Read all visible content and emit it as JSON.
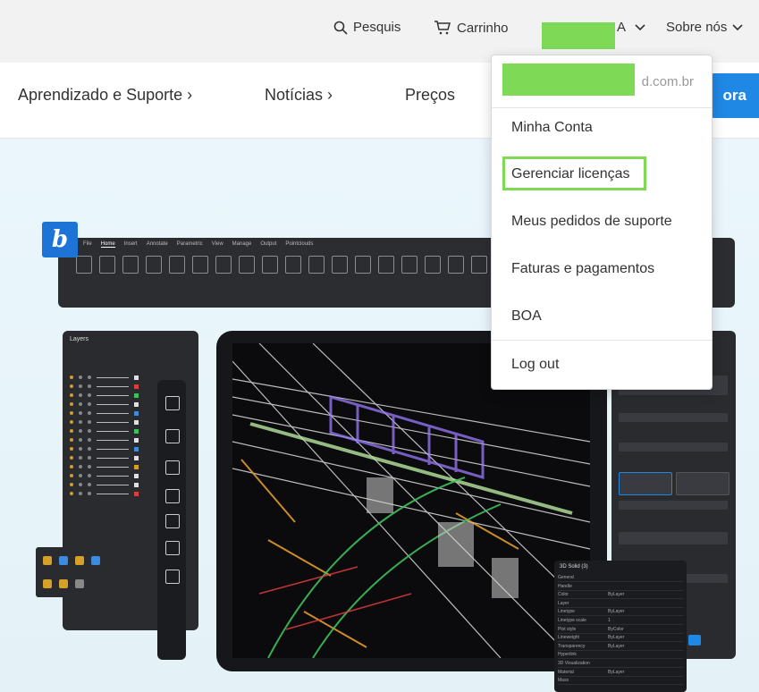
{
  "topbar": {
    "search_label": "Pesquis",
    "cart_label": "Carrinho",
    "account_suffix": "A",
    "about_label": "Sobre nós"
  },
  "nav": {
    "items": [
      "Aprendizado e Suporte",
      "Notícias",
      "Preços"
    ],
    "chevron": "›",
    "cta_label": "ora"
  },
  "app": {
    "logo_letter": "b",
    "ribbon_tabs": [
      "File",
      "Home",
      "Insert",
      "Annotate",
      "Parametric",
      "View",
      "Manage",
      "Output",
      "Pointclouds"
    ],
    "layers_title": "Layers",
    "prop_title": "3D Solid (3)",
    "prop_rows": [
      "General",
      "Handle",
      "Color",
      "Layer",
      "Linetype",
      "Linetype scale",
      "Plot style",
      "Lineweight",
      "Transparency",
      "Hyperlink",
      "3D Visualization",
      "Material",
      "Mass"
    ],
    "prop_values": [
      "",
      "",
      "ByLayer",
      "",
      "ByLayer",
      "1",
      "ByColor",
      "ByLayer",
      "ByLayer",
      "",
      "",
      "ByLayer",
      ""
    ]
  },
  "dropdown": {
    "email_suffix": "d.com.br",
    "items": [
      "Minha Conta",
      "Gerenciar licenças",
      "Meus pedidos de suporte",
      "Faturas e pagamentos",
      "BOA",
      "Log out"
    ],
    "highlighted_item": "Gerenciar licenças"
  },
  "colors": {
    "highlight_green": "#7ed957",
    "accent_blue": "#1f88e5",
    "app_dark": "#2a2b2e"
  }
}
